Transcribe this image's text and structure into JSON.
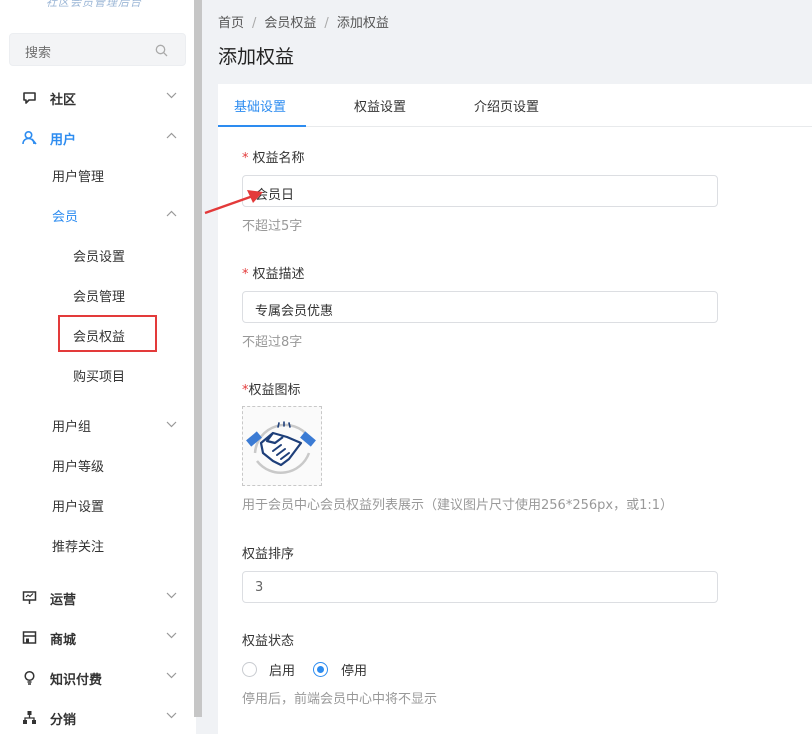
{
  "sidebar": {
    "logo_text": "社区会员管理后台",
    "search_placeholder": "搜索",
    "groups": {
      "community": "社区",
      "user": "用户",
      "operations": "运营",
      "mall": "商城",
      "knowledge": "知识付费",
      "distribution": "分销"
    },
    "user_items": {
      "user_manage": "用户管理",
      "member": "会员",
      "member_settings": "会员设置",
      "member_manage": "会员管理",
      "member_rights": "会员权益",
      "purchase_items": "购买项目",
      "user_group": "用户组",
      "user_level": "用户等级",
      "user_settings": "用户设置",
      "recommend_follow": "推荐关注"
    }
  },
  "breadcrumb": [
    "首页",
    "会员权益",
    "添加权益"
  ],
  "breadcrumb_sep": "/",
  "page_title": "添加权益",
  "tabs": [
    "基础设置",
    "权益设置",
    "介绍页设置"
  ],
  "form": {
    "name_label": "权益名称",
    "name_value": "会员日",
    "name_hint": "不超过5字",
    "desc_label": "权益描述",
    "desc_value": "专属会员优惠",
    "desc_hint": "不超过8字",
    "icon_label": "权益图标",
    "icon_hint": "用于会员中心会员权益列表展示（建议图片尺寸使用256*256px，或1:1）",
    "sort_label": "权益排序",
    "sort_value": "3",
    "status_label": "权益状态",
    "status_options": [
      "启用",
      "停用"
    ],
    "status_selected": "停用",
    "status_hint": "停用后，前端会员中心中将不显示",
    "required_mark": "*"
  },
  "colors": {
    "accent": "#2d8cf0",
    "required": "#e33a3a",
    "annotation": "#e33a3a"
  }
}
